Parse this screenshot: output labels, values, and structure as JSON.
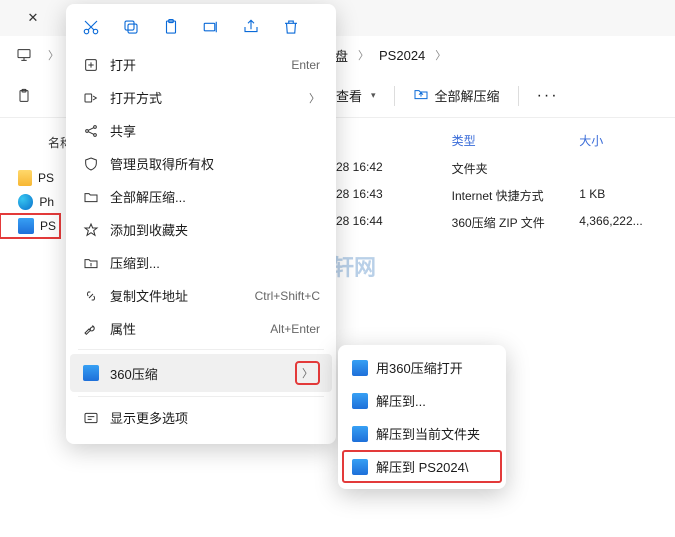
{
  "tabbar": {
    "close_glyph": "✕"
  },
  "breadcrumb": {
    "seg1": "盘",
    "seg2": "PS2024"
  },
  "toolbar": {
    "view_label": "查看",
    "extract_all_label": "全部解压缩",
    "more_glyph": "···"
  },
  "sidebar": {
    "name_header": "名称",
    "items": [
      {
        "label": "PS"
      },
      {
        "label": "Ph"
      },
      {
        "label": "PS"
      }
    ]
  },
  "filelist": {
    "headers": {
      "type": "类型",
      "size": "大小"
    },
    "rows": [
      {
        "date": "-28 16:42",
        "type": "文件夹",
        "size": ""
      },
      {
        "date": "-28 16:43",
        "type": "Internet 快捷方式",
        "size": "1 KB"
      },
      {
        "date": "-28 16:44",
        "type": "360压缩 ZIP 文件",
        "size": "4,366,222..."
      }
    ]
  },
  "ctx": {
    "open": "打开",
    "open_accel": "Enter",
    "open_with": "打开方式",
    "share": "共享",
    "admin_ownership": "管理员取得所有权",
    "extract_all": "全部解压缩...",
    "add_fav": "添加到收藏夹",
    "compress_to": "压缩到...",
    "copy_path": "复制文件地址",
    "copy_path_accel": "Ctrl+Shift+C",
    "properties": "属性",
    "properties_accel": "Alt+Enter",
    "zip360": "360压缩",
    "show_more": "显示更多选项"
  },
  "submenu": {
    "open_with_360": "用360压缩打开",
    "extract_to": "解压到...",
    "extract_here": "解压到当前文件夹",
    "extract_to_folder": "解压到 PS2024\\"
  },
  "watermark": {
    "text": "腾轩网"
  }
}
